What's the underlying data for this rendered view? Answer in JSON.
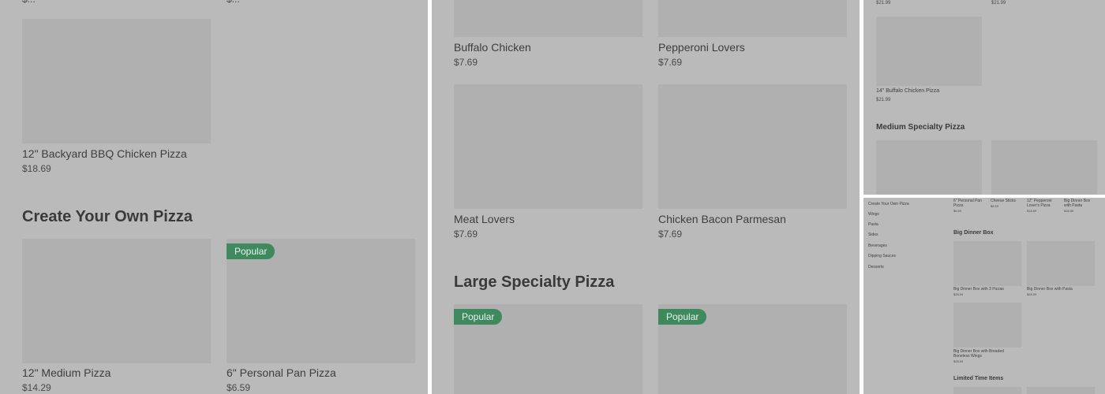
{
  "panel1": {
    "top_prices": {
      "left": "$...",
      "right": "$..."
    },
    "bbq_item": {
      "name": "12\" Backyard BBQ Chicken Pizza",
      "price": "$18.69"
    },
    "section_title": "Create Your Own Pizza",
    "items": [
      {
        "name": "12\" Medium Pizza",
        "price": "$14.29"
      },
      {
        "name": "6\" Personal Pan Pizza",
        "price": "$6.59",
        "badge": "Popular"
      }
    ]
  },
  "panel2": {
    "items": [
      {
        "name": "Buffalo Chicken",
        "price": "$7.69"
      },
      {
        "name": "Pepperoni Lovers",
        "price": "$7.69"
      },
      {
        "name": "Meat Lovers",
        "price": "$7.69"
      },
      {
        "name": "Chicken Bacon Parmesan",
        "price": "$7.69"
      }
    ],
    "section_title": "Large Specialty Pizza",
    "badges": [
      "Popular",
      "Popular"
    ]
  },
  "panel3": {
    "top_prices": [
      "$21.99",
      "$21.99"
    ],
    "item": {
      "name": "14\" Buffalo Chicken Pizza",
      "price": "$21.99"
    },
    "section_title": "Medium Specialty Pizza"
  },
  "panel4": {
    "nav": [
      "Create Your Own Pizza",
      "Wings",
      "Pasta",
      "Sides",
      "Beverages",
      "Dipping Sauces",
      "Desserts"
    ],
    "top_items": [
      {
        "name": "6\" Personal Pan Pizza",
        "price": "$6.59"
      },
      {
        "name": "Cheese Sticks",
        "price": "$8.59"
      },
      {
        "name": "12\" Pepperoni Lover's Pizza",
        "price": "$18.69"
      },
      {
        "name": "Big Dinner Box with Pasta",
        "price": "$28.59"
      }
    ],
    "section_title": "Big Dinner Box",
    "box_items": [
      {
        "name": "Big Dinner Box with 3 Pizzas",
        "price": "$28.59"
      },
      {
        "name": "Big Dinner Box with Pasta",
        "price": "$28.59"
      },
      {
        "name": "Big Dinner Box with Breaded Boneless Wings",
        "price": "$28.59"
      }
    ],
    "section2_title": "Limited Time Items"
  }
}
